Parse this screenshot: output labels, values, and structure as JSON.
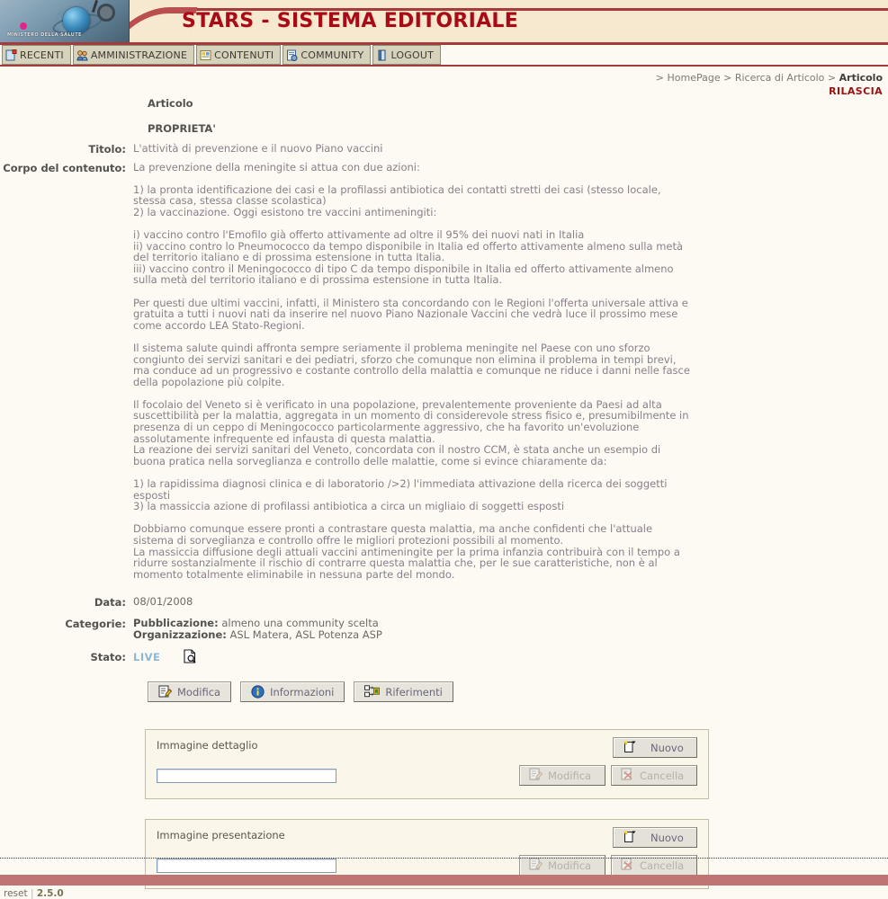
{
  "header": {
    "title": "STARS - SISTEMA EDITORIALE",
    "logo_caption": "MINISTERO DELLA SALUTE"
  },
  "tabs": [
    {
      "label": "RECENTI",
      "icon": "recent-document-icon"
    },
    {
      "label": "AMMINISTRAZIONE",
      "icon": "users-icon"
    },
    {
      "label": "CONTENUTI",
      "icon": "content-icon"
    },
    {
      "label": "COMMUNITY",
      "icon": "community-icon"
    },
    {
      "label": "LOGOUT",
      "icon": "door-exit-icon"
    }
  ],
  "breadcrumb": {
    "prefix": "> HomePage > Ricerca di Articolo > ",
    "current": "Articolo",
    "action": "RILASCIA"
  },
  "article": {
    "kind": "Articolo",
    "section_heading": "PROPRIETA'",
    "fields": {
      "titolo_label": "Titolo:",
      "titolo_value": "L'attività di prevenzione e il nuovo Piano vaccini",
      "corpo_label": "Corpo del contenuto:",
      "corpo_intro": "La prevenzione della meningite si attua con due azioni:",
      "corpo_value": "1) la pronta identificazione dei casi e la profilassi antibiotica dei contatti stretti dei casi (stesso locale, stessa casa, stessa classe scolastica)\n2) la vaccinazione. Oggi esistono tre vaccini antimeningiti:\n\ni) vaccino contro l'Emofilo già offerto attivamente ad oltre il 95% dei nuovi nati in Italia\nii) vaccino contro lo Pneumococco da tempo disponibile in Italia ed offerto attivamente almeno sulla metà del territorio italiano e di prossima estensione in tutta Italia.\niii) vaccino contro il Meningococco di tipo C da tempo disponibile in Italia ed offerto attivamente almeno sulla metà del territorio italiano e di prossima estensione in tutta Italia.\n\nPer questi due ultimi vaccini, infatti, il Ministero sta concordando con le Regioni l'offerta universale attiva e gratuita a tutti i nuovi nati da inserire nel nuovo Piano Nazionale Vaccini che vedrà luce il prossimo mese come accordo LEA Stato-Regioni.\n\nIl sistema salute quindi affronta sempre seriamente il problema meningite nel Paese con uno sforzo congiunto dei servizi sanitari e dei pediatri, sforzo che comunque non elimina il problema in tempi brevi, ma conduce ad un progressivo e costante controllo della malattia e comunque ne riduce i danni nelle fasce della popolazione più colpite.\n\nIl focolaio del Veneto si è verificato in una popolazione, prevalentemente proveniente da Paesi ad alta suscettibilità per la malattia, aggregata in un momento di considerevole stress fisico e, presumibilmente in presenza di un ceppo di Meningococco particolarmente aggressivo, che ha favorito un'evoluzione assolutamente infrequente ed infausta di questa malattia.\nLa reazione dei servizi sanitari del Veneto, concordata con il nostro CCM, è stata anche un esempio di buona pratica nella sorveglianza e controllo delle malattie, come si evince chiaramente da:\n\n1) la rapidissima diagnosi clinica e di laboratorio />2) l'immediata attivazione della ricerca dei soggetti esposti\n3) la massiccia azione di profilassi antibiotica a circa un migliaio di soggetti esposti\n\nDobbiamo comunque essere pronti a contrastare questa malattia, ma anche confidenti che l'attuale sistema di sorveglianza e controllo offre le migliori protezioni possibili al momento.\nLa massiccia diffusione degli attuali vaccini antimeningite per la prima infanzia contribuirà con il tempo a ridurre sostanzialmente il rischio di contrarre questa malattia che, per le sue caratteristiche, non è al momento totalmente eliminabile in nessuna parte del mondo.",
      "data_label": "Data:",
      "data_value": "08/01/2008",
      "categorie_label": "Categorie:",
      "categorie_pubblicazione_key": "Pubblicazione:",
      "categorie_pubblicazione_value": " almeno una community scelta",
      "categorie_organizzazione_key": "Organizzazione:",
      "categorie_organizzazione_value": " ASL Matera, ASL Potenza ASP",
      "stato_label": "Stato:",
      "stato_value": "LIVE"
    }
  },
  "actions": [
    {
      "label": "Modifica",
      "icon": "edit-document-icon"
    },
    {
      "label": "Informazioni",
      "icon": "info-circle-icon"
    },
    {
      "label": "Riferimenti",
      "icon": "references-icon"
    }
  ],
  "panels": [
    {
      "title": "Immagine dettaglio",
      "input_value": "",
      "input_placeholder": "",
      "new_label": "Nuovo",
      "edit_label": "Modifica",
      "delete_label": "Cancella"
    },
    {
      "title": "Immagine presentazione",
      "input_value": "",
      "input_placeholder": "",
      "new_label": "Nuovo",
      "edit_label": "Modifica",
      "delete_label": "Cancella"
    }
  ],
  "footer": {
    "reset": "reset",
    "separator": "|",
    "version": "2.5.0"
  },
  "colors": {
    "brand_red": "#a80a17",
    "rule_red": "#a43c3c",
    "footer_bar": "#c07575",
    "page_bg": "#fdf9f3",
    "banner_bg": "#f7e9cf",
    "tab_bg": "#d7d2bc",
    "panel_bg": "#fbf6ea",
    "live_blue": "#8ab8d8"
  }
}
